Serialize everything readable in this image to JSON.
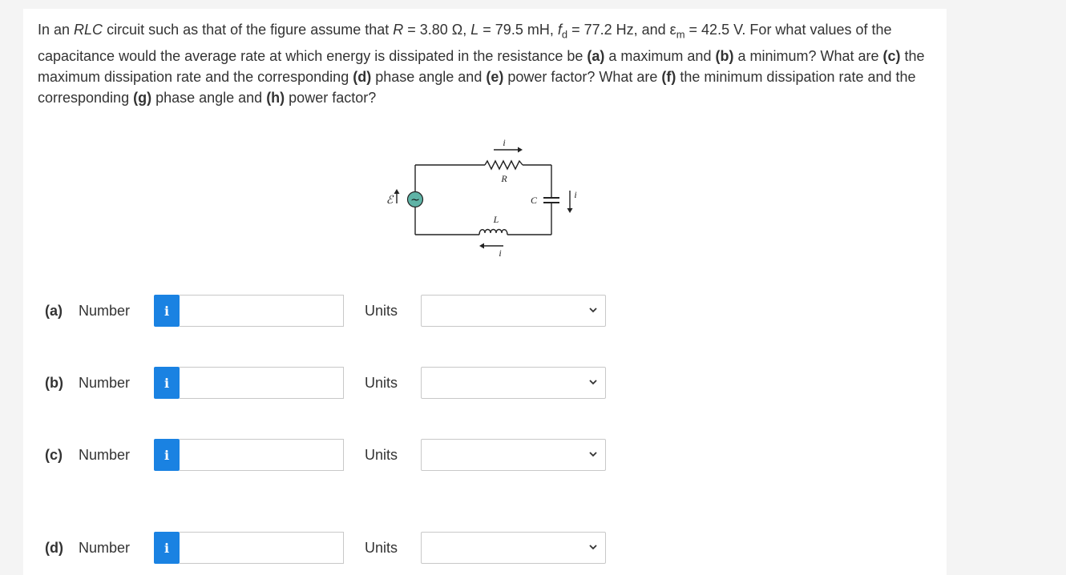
{
  "question": {
    "t1": "In an ",
    "t2": "RLC",
    "t3": " circuit such as that of the figure assume that ",
    "t4": "R",
    "t5": " = 3.80 Ω, ",
    "t6": "L",
    "t7": " = 79.5 mH, ",
    "t8": "f",
    "t9": "d",
    "t10": " = 77.2 Hz, and ε",
    "t11": "m",
    "t12": " = 42.5 V. For what values of the capacitance would the average rate at which energy is dissipated in the resistance be ",
    "t13": "(a)",
    "t14": " a maximum and ",
    "t15": "(b)",
    "t16": " a minimum? What are ",
    "t17": "(c)",
    "t18": " the maximum dissipation rate and the corresponding ",
    "t19": "(d)",
    "t20": " phase angle and ",
    "t21": "(e)",
    "t22": " power factor? What are ",
    "t23": "(f)",
    "t24": " the minimum dissipation rate and the corresponding ",
    "t25": "(g)",
    "t26": " phase angle and ",
    "t27": "(h)",
    "t28": " power factor?"
  },
  "figure": {
    "i_top": "i",
    "r_label": "R",
    "c_label": "C",
    "i_right": "i",
    "l_label": "L",
    "i_bottom": "i",
    "emf_label": "ℰ",
    "source_symbol": "~"
  },
  "answers": [
    {
      "part": "(a)",
      "number_label": "Number",
      "info": "i",
      "value": "",
      "units_label": "Units",
      "units_value": ""
    },
    {
      "part": "(b)",
      "number_label": "Number",
      "info": "i",
      "value": "",
      "units_label": "Units",
      "units_value": ""
    },
    {
      "part": "(c)",
      "number_label": "Number",
      "info": "i",
      "value": "",
      "units_label": "Units",
      "units_value": ""
    },
    {
      "part": "(d)",
      "number_label": "Number",
      "info": "i",
      "value": "",
      "units_label": "Units",
      "units_value": ""
    }
  ],
  "colors": {
    "info_button": "#1a82e2",
    "source_fill": "#5fb3a6",
    "background": "#f4f4f4",
    "card": "#ffffff"
  },
  "icons": {
    "info": "info-icon",
    "select": "chevron-down-icon"
  }
}
